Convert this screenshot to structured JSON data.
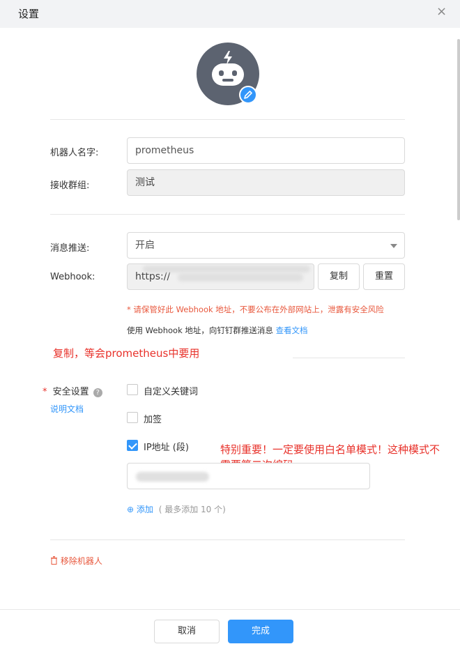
{
  "dialog": {
    "title": "设置",
    "close_icon": "×"
  },
  "robot": {
    "name_label": "机器人名字:",
    "name_value": "prometheus",
    "group_label": "接收群组:",
    "group_value": "测试"
  },
  "push": {
    "label": "消息推送:",
    "value": "开启"
  },
  "webhook": {
    "label": "Webhook:",
    "value_prefix": "https://",
    "copy_label": "复制",
    "reset_label": "重置",
    "warning": "* 请保管好此 Webhook 地址，不要公布在外部网站上，泄露有安全风险",
    "hint": "使用 Webhook 地址，向钉钉群推送消息",
    "doc_link": "查看文档"
  },
  "annotations": {
    "copy_note": "复制，等会prometheus中要用",
    "ip_note_line1": "特别重要！一定要使用白名单模式！这种模式不",
    "ip_note_line2": "需要第二次编码"
  },
  "security": {
    "required_mark": "*",
    "label": "安全设置",
    "help_icon": "?",
    "doc_link": "说明文档",
    "options": [
      {
        "label": "自定义关键词",
        "checked": false
      },
      {
        "label": "加签",
        "checked": false
      },
      {
        "label": "IP地址 (段)",
        "checked": true
      }
    ],
    "add_icon": "⊕",
    "add_label": "添加",
    "add_hint": "( 最多添加 10 个)"
  },
  "remove": {
    "icon": "🗑",
    "label": "移除机器人"
  },
  "footer": {
    "cancel_label": "取消",
    "confirm_label": "完成"
  },
  "colors": {
    "primary": "#3296fa",
    "warning": "#e8583d",
    "annotation": "#e8312a"
  }
}
